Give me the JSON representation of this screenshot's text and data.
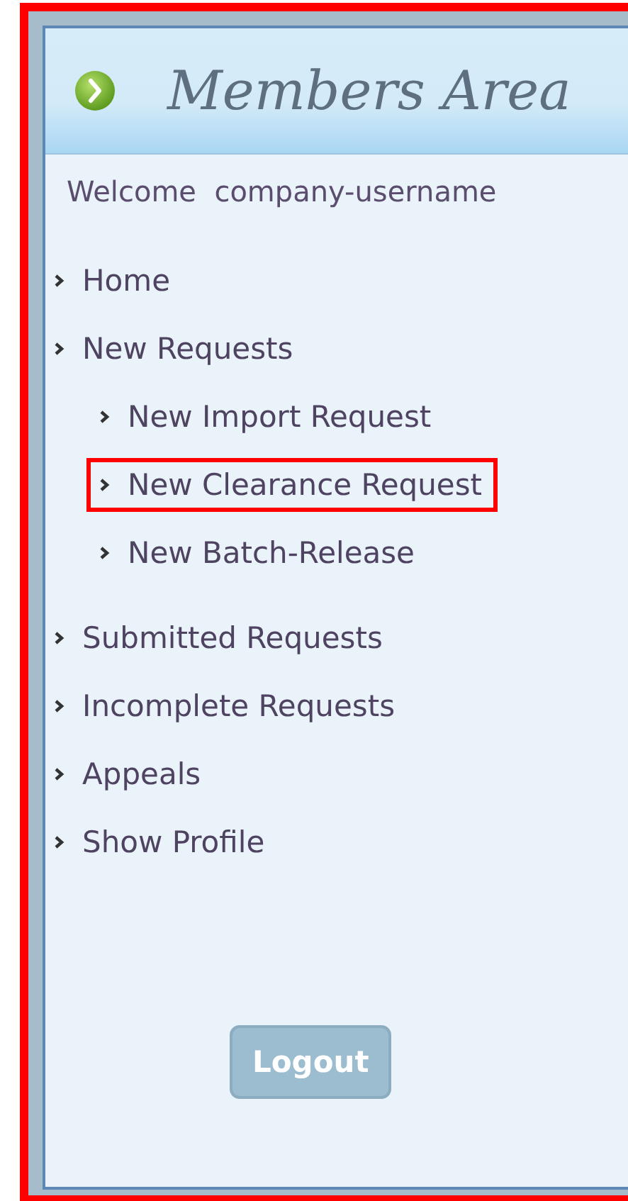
{
  "panel": {
    "title": "Members Area",
    "welcome": "Welcome  company-username"
  },
  "menu": [
    {
      "label": "Home",
      "highlighted": false
    },
    {
      "label": "New Requests",
      "highlighted": false,
      "children": [
        {
          "label": "New Import Request",
          "highlighted": false
        },
        {
          "label": "New Clearance Request",
          "highlighted": true
        },
        {
          "label": "New Batch-Release",
          "highlighted": false
        }
      ]
    },
    {
      "label": "Submitted Requests",
      "highlighted": false
    },
    {
      "label": "Incomplete Requests",
      "highlighted": false
    },
    {
      "label": "Appeals",
      "highlighted": false
    },
    {
      "label": "Show Profile",
      "highlighted": false
    }
  ],
  "logout": "Logout"
}
